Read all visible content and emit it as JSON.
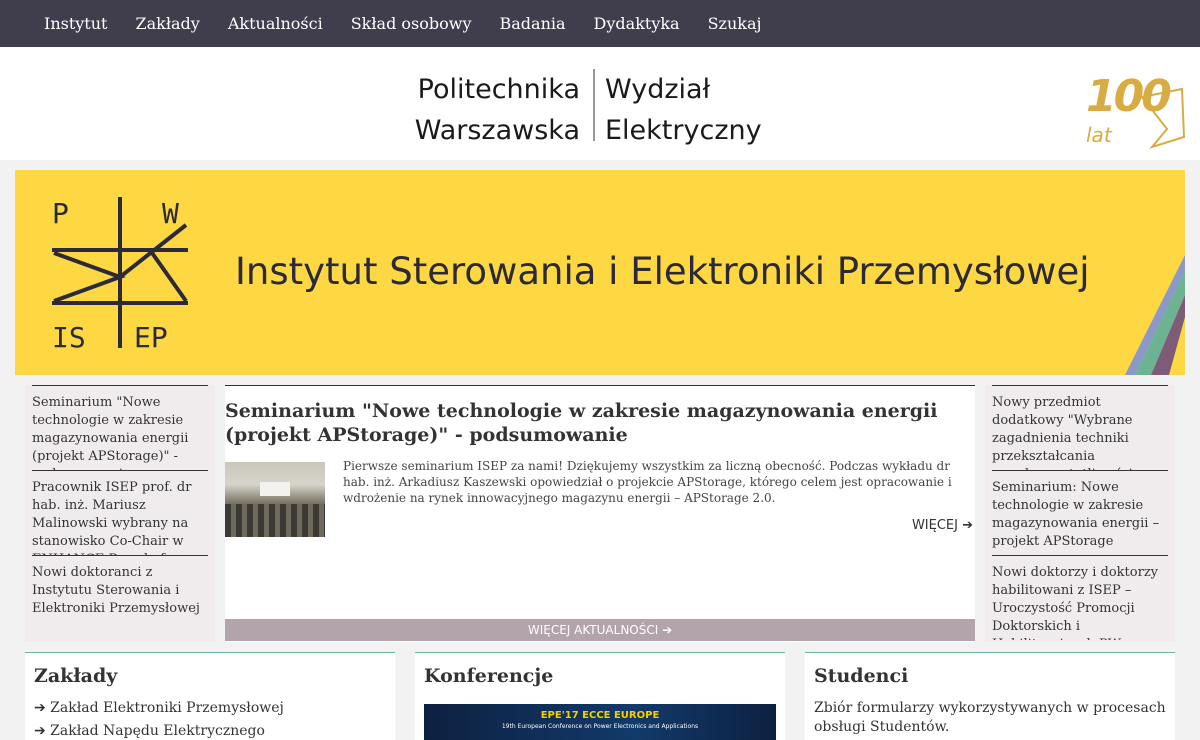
{
  "nav": {
    "items": [
      "Instytut",
      "Zakłady",
      "Aktualności",
      "Skład osobowy",
      "Badania",
      "Dydaktyka",
      "Szukaj"
    ]
  },
  "header": {
    "pw_line1": "Politechnika",
    "pw_line2": "Warszawska",
    "wel_line1": "Wydział",
    "wel_line2": "Elektryczny",
    "anniversary_number": "100",
    "anniversary_word": "lat"
  },
  "banner": {
    "logo_letters": [
      "P",
      "W",
      "IS",
      "EP"
    ],
    "title": "Instytut Sterowania i Elektroniki Przemysłowej",
    "background_color": "#fdd843"
  },
  "news_left": [
    "Seminarium \"Nowe technologie w zakresie magazynowania energii (projekt APStorage)\" - podsumowanie",
    "Pracownik ISEP prof. dr hab. inż. Mariusz Malinowski wybrany na stanowisko Co-Chair w ENHANCE Board of Directors",
    "Nowi doktoranci z Instytutu Sterowania i Elektroniki Przemysłowej"
  ],
  "featured": {
    "title": "Seminarium \"Nowe technologie w zakresie magazynowania energii (projekt APStorage)\" - podsumowanie",
    "excerpt": "Pierwsze seminarium ISEP za nami! Dziękujemy wszystkim za liczną obecność. Podczas wykładu dr hab. inż. Arkadiusz Kaszewski opowiedział o projekcie APStorage, którego celem jest opracowanie i wdrożenie na rynek innowacyjnego magazynu energii – APStorage 2.0.",
    "more_label": "WIĘCEJ ➔",
    "more_all_label": "WIĘCEJ AKTUALNOŚCI ➔"
  },
  "news_right": [
    "Nowy przedmiot dodatkowy \"Wybrane zagadnienia techniki przekształcania wysokoczęstotliwościowego\"",
    "Seminarium: Nowe technologie w zakresie magazynowania energii – projekt APStorage",
    "Nowi doktorzy i doktorzy habilitowani z ISEP – Uroczystość Promocji Doktorskich i Habilitacyjnych PW"
  ],
  "sections": {
    "zaklady": {
      "title": "Zakłady",
      "items": [
        "➔ Zakład Elektroniki Przemysłowej",
        "➔ Zakład Napędu Elektrycznego"
      ]
    },
    "konferencje": {
      "title": "Konferencje",
      "image_title": "EPE'17 ECCE EUROPE",
      "image_subtitle": "19th European Conference on Power Electronics and Applications"
    },
    "studenci": {
      "title": "Studenci",
      "text": "Zbiór formularzy wykorzystywanych w procesach obsługi Studentów."
    }
  },
  "colors": {
    "nav_bg": "#403e4c",
    "accent_gold": "#d8ac43",
    "section_rule": "#6cb393",
    "more_bar": "#b3a4ac"
  }
}
